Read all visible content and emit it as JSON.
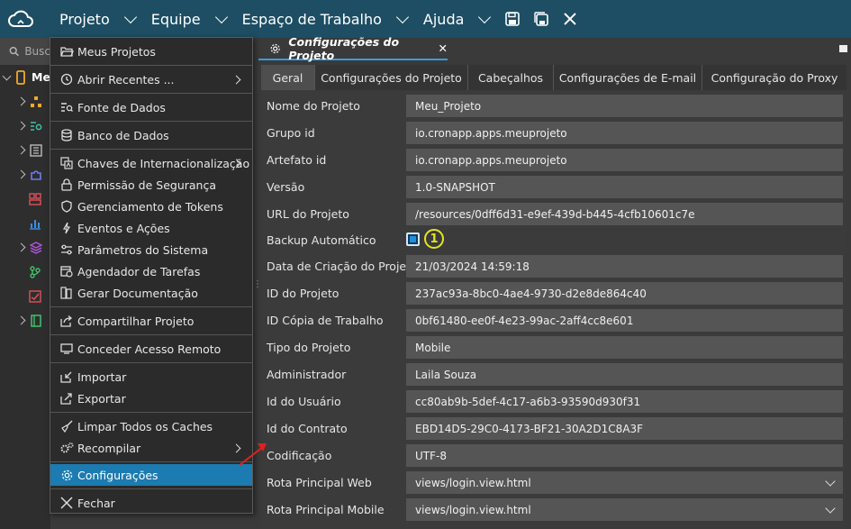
{
  "menubar": {
    "items": [
      {
        "label": "Projeto"
      },
      {
        "label": "Equipe"
      },
      {
        "label": "Espaço de Trabalho"
      },
      {
        "label": "Ajuda"
      }
    ],
    "tools": [
      "save-icon",
      "save-all-icon",
      "close-icon"
    ]
  },
  "sidebar": {
    "search_placeholder": "Busc",
    "root_label": "Me"
  },
  "dropdown": {
    "items": [
      {
        "label": "Meus Projetos",
        "icon": "folder-open-icon"
      },
      {
        "label": "Abrir Recentes ...",
        "icon": "history-icon"
      },
      {
        "label": "Fonte de Dados",
        "icon": "data-source-icon"
      },
      {
        "label": "Banco de Dados",
        "icon": "database-icon"
      },
      {
        "label": "Chaves de Internacionalização",
        "icon": "translate-icon"
      },
      {
        "label": "Permissão de Segurança",
        "icon": "lock-icon"
      },
      {
        "label": "Gerenciamento de Tokens",
        "icon": "token-icon"
      },
      {
        "label": "Eventos e Ações",
        "icon": "lightning-icon"
      },
      {
        "label": "Parâmetros do Sistema",
        "icon": "sliders-icon"
      },
      {
        "label": "Agendador de Tarefas",
        "icon": "calendar-clock-icon"
      },
      {
        "label": "Gerar Documentação",
        "icon": "documentation-icon"
      },
      {
        "label": "Compartilhar Projeto",
        "icon": "share-icon"
      },
      {
        "label": "Conceder Acesso Remoto",
        "icon": "remote-access-icon"
      },
      {
        "label": "Importar",
        "icon": "import-icon"
      },
      {
        "label": "Exportar",
        "icon": "export-icon"
      },
      {
        "label": "Limpar Todos os Caches",
        "icon": "broom-icon"
      },
      {
        "label": "Recompilar",
        "icon": "cogs-icon"
      },
      {
        "label": "Configurações",
        "icon": "gear-icon"
      },
      {
        "label": "Fechar",
        "icon": "close-icon"
      }
    ]
  },
  "editor": {
    "tab_title": "Configurações do Projeto",
    "subtabs": [
      {
        "label": "Geral"
      },
      {
        "label": "Configurações do Projeto"
      },
      {
        "label": "Cabeçalhos"
      },
      {
        "label": "Configurações de E-mail"
      },
      {
        "label": "Configuração do Proxy"
      }
    ],
    "active_subtab": "Geral",
    "fields": [
      {
        "label": "Nome do Projeto",
        "value": "Meu_Projeto"
      },
      {
        "label": "Grupo id",
        "value": "io.cronapp.apps.meuprojeto"
      },
      {
        "label": "Artefato id",
        "value": "io.cronapp.apps.meuprojeto"
      },
      {
        "label": "Versão",
        "value": "1.0-SNAPSHOT"
      },
      {
        "label": "URL do Projeto",
        "value": "/resources/0dff6d31-e9ef-439d-b445-4cfb10601c7e"
      },
      {
        "label": "Backup Automático",
        "checked": true,
        "badge": "1"
      },
      {
        "label": "Data de Criação do Projeto",
        "value": "21/03/2024 14:59:18"
      },
      {
        "label": "ID do Projeto",
        "value": "237ac93a-8bc0-4ae4-9730-d2e8de864c40"
      },
      {
        "label": "ID Cópia de Trabalho",
        "value": "0bf61480-ee0f-4e23-99ac-2aff4cc8e601"
      },
      {
        "label": "Tipo do Projeto",
        "value": "Mobile"
      },
      {
        "label": "Administrador",
        "value": "Laila Souza"
      },
      {
        "label": "Id do Usuário",
        "value": "cc80ab9b-5def-4c17-a6b3-93590d930f31"
      },
      {
        "label": "Id do Contrato",
        "value": "EBD14D5-29C0-4173-BF21-30A2D1C8A3F"
      },
      {
        "label": "Codificação",
        "value": "UTF-8"
      },
      {
        "label": "Rota Principal Web",
        "value": "views/login.view.html"
      },
      {
        "label": "Rota Principal Mobile",
        "value": "views/login.view.html"
      }
    ]
  },
  "colors": {
    "topbar": "#1d4e63",
    "active_item": "#1c7bb0",
    "tab_underline": "#3b9be0",
    "badge": "#e3e61c"
  }
}
